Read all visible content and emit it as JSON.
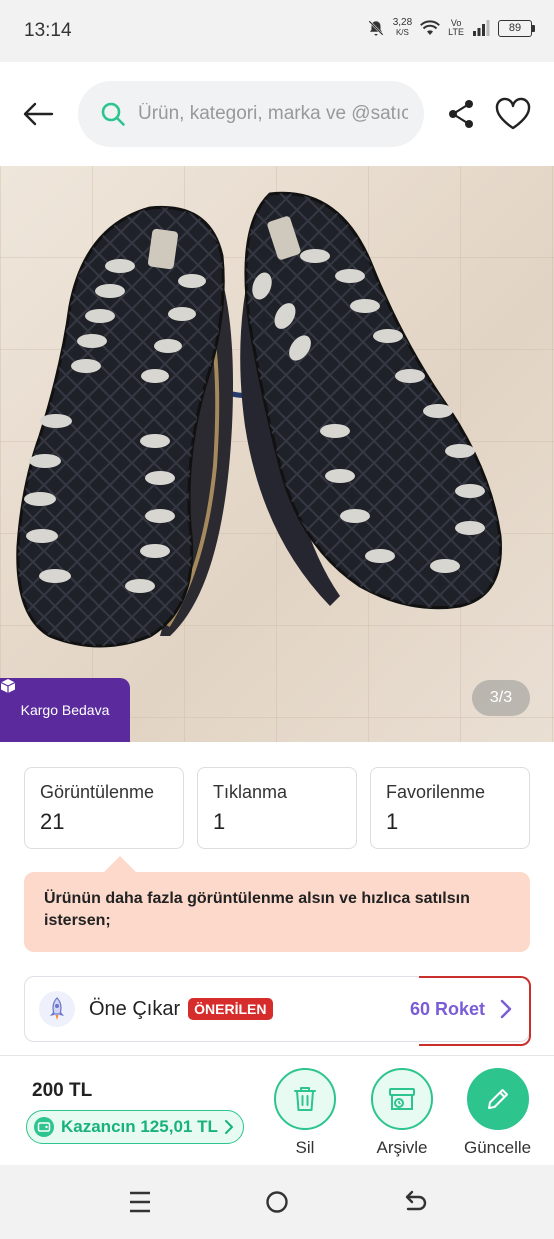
{
  "status_bar": {
    "time": "13:14",
    "net_speed": "3,28",
    "net_unit": "K/S",
    "network_top": "Vo",
    "network_bottom": "LTE",
    "battery": "89"
  },
  "header": {
    "search_placeholder": "Ürün, kategori, marka ve @satıcı ara"
  },
  "gallery": {
    "badge_label": "Kargo Bedava",
    "counter": "3/3"
  },
  "stats": [
    {
      "label": "Görüntülenme",
      "value": "21"
    },
    {
      "label": "Tıklanma",
      "value": "1"
    },
    {
      "label": "Favorilenme",
      "value": "1"
    }
  ],
  "tip": {
    "text": "Ürünün daha fazla görüntülenme alsın ve hızlıca satılsın istersen;"
  },
  "promo": {
    "title": "Öne Çıkar",
    "badge": "ÖNERİLEN",
    "price": "60 Roket"
  },
  "bottom": {
    "price": "200 TL",
    "earnings": "Kazancın 125,01 TL",
    "actions": {
      "delete": "Sil",
      "archive": "Arşivle",
      "update": "Güncelle"
    }
  },
  "colors": {
    "accent_green": "#2dc48d",
    "brand_purple": "#5b2b9e",
    "promo_badge_red": "#d62c2c",
    "roket_purple": "#7a5cd6",
    "tip_bg": "#fcd9cb"
  }
}
